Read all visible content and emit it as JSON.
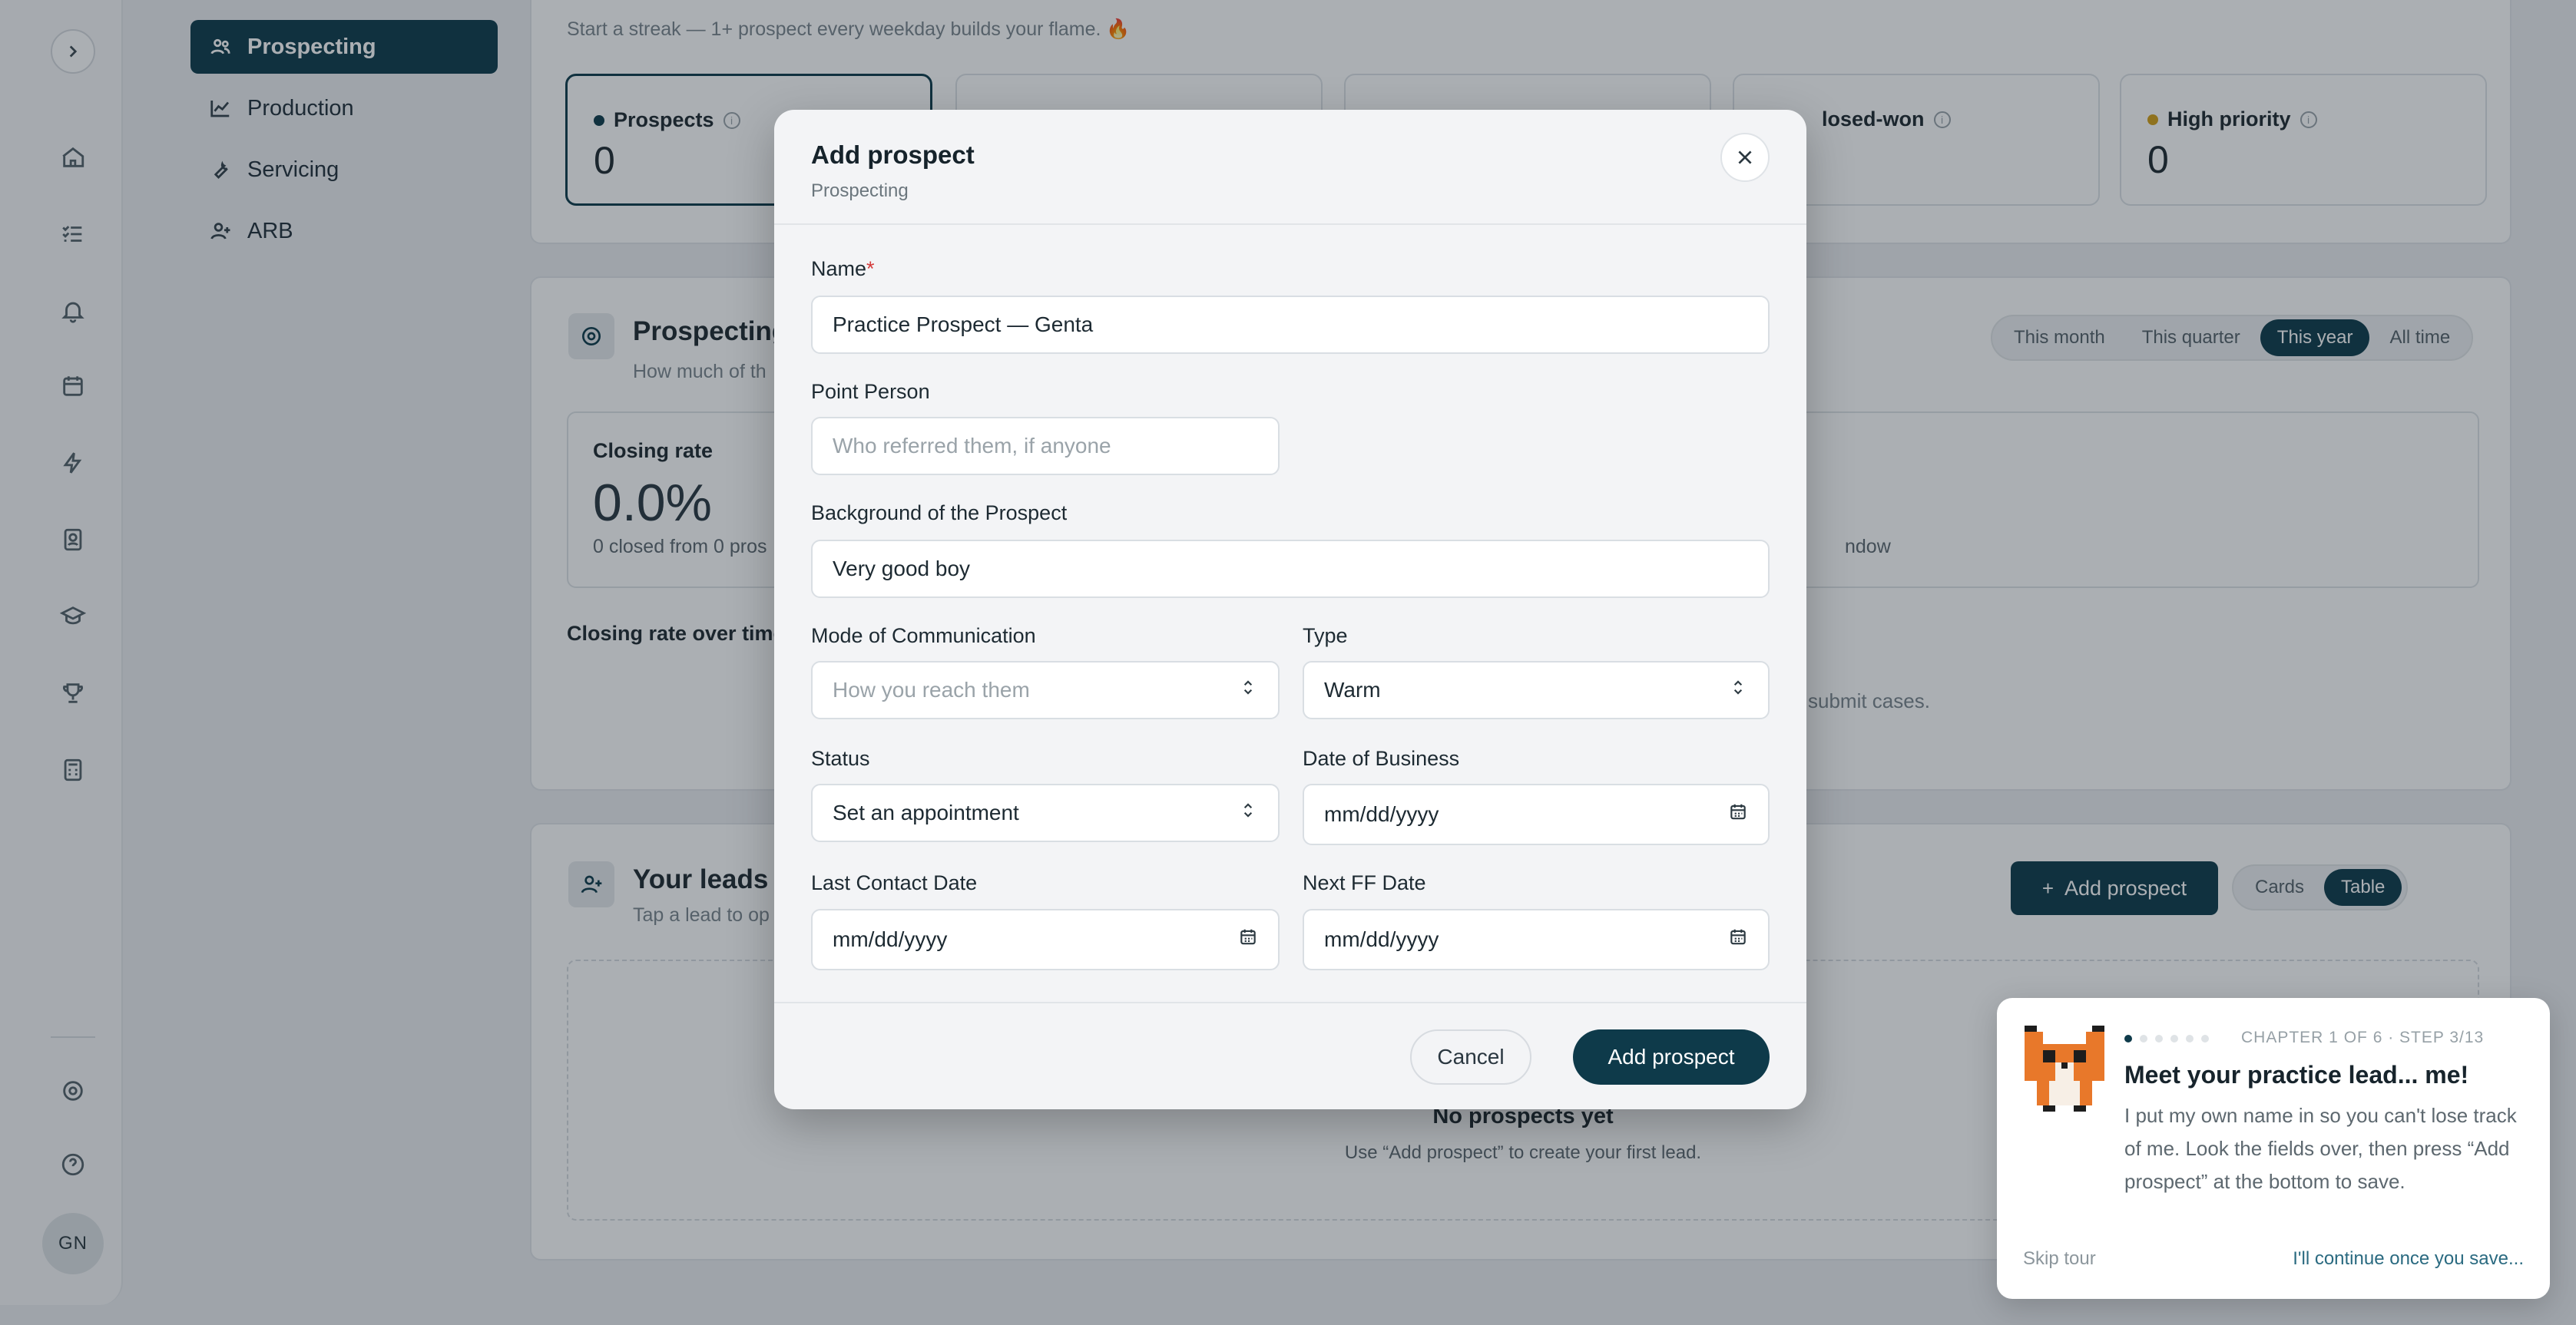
{
  "sidebar": {
    "nav": [
      "Prospecting",
      "Production",
      "Servicing",
      "ARB"
    ],
    "avatar": "GN"
  },
  "page": {
    "streak_text": "Start a streak — 1+ prospect every weekday builds your flame. 🔥",
    "stats": [
      {
        "label": "Prospects",
        "value": "0",
        "color": "#0e3a4a"
      },
      {
        "label": "losed-won",
        "value": ""
      },
      {
        "label": "High priority",
        "value": "0",
        "color": "#d4a017"
      }
    ],
    "prospecting_section": {
      "title": "Prospecting",
      "subtitle": "How much of th",
      "periods": [
        "This month",
        "This quarter",
        "This year",
        "All time"
      ],
      "active_period": "This year",
      "closing_rate_label": "Closing rate",
      "closing_rate_value": "0.0%",
      "closing_rate_caption": "0 closed from 0 pros",
      "window_fragment": "ndow",
      "over_time_label": "Closing rate over time",
      "submit_fragment": "submit cases."
    },
    "leads_section": {
      "title": "Your leads",
      "subtitle": "Tap a lead to op",
      "add_button": "Add prospect",
      "views": [
        "Cards",
        "Table"
      ],
      "active_view": "Table",
      "empty_title": "No prospects yet",
      "empty_caption": "Use “Add prospect” to create your first lead."
    }
  },
  "modal": {
    "title": "Add prospect",
    "subtitle": "Prospecting",
    "fields": {
      "name": {
        "label": "Name",
        "value": "Practice Prospect — Genta"
      },
      "point_person": {
        "label": "Point Person",
        "placeholder": "Who referred them, if anyone"
      },
      "background": {
        "label": "Background of the Prospect",
        "value": "Very good boy"
      },
      "mode": {
        "label": "Mode of Communication",
        "placeholder": "How you reach them"
      },
      "type": {
        "label": "Type",
        "value": "Warm"
      },
      "status": {
        "label": "Status",
        "value": "Set an appointment"
      },
      "date_business": {
        "label": "Date of Business",
        "placeholder": "mm/dd/yyyy"
      },
      "last_contact": {
        "label": "Last Contact Date",
        "placeholder": "mm/dd/yyyy"
      },
      "next_ff": {
        "label": "Next FF Date",
        "placeholder": "mm/dd/yyyy"
      }
    },
    "cancel": "Cancel",
    "submit": "Add prospect"
  },
  "tour": {
    "step_label": "CHAPTER 1 OF 6 · STEP 3/13",
    "title": "Meet your practice lead... me!",
    "body": "I put my own name in so you can't lose track of me. Look the fields over, then press “Add prospect” at the bottom to save.",
    "skip": "Skip tour",
    "continue": "I'll continue once you save..."
  }
}
